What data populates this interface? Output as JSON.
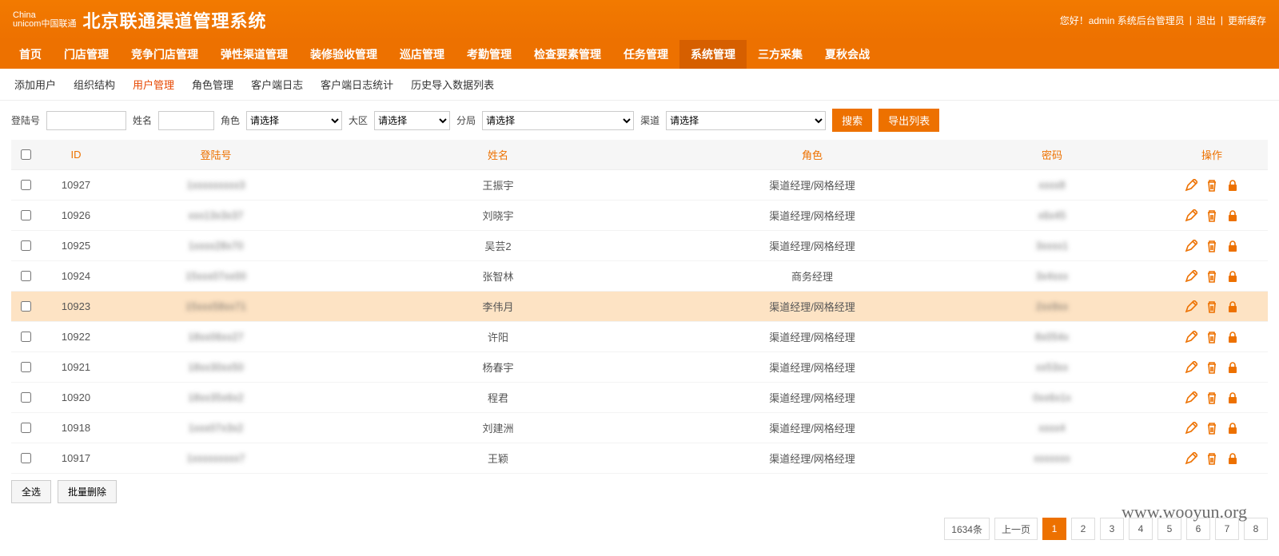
{
  "header": {
    "logo_small1": "China",
    "logo_small2": "unicom中国联通",
    "title": "北京联通渠道管理系统",
    "greeting": "您好！admin 系统后台管理员",
    "logout": "退出",
    "refresh": "更新缓存"
  },
  "nav": [
    "首页",
    "门店管理",
    "竞争门店管理",
    "弹性渠道管理",
    "装修验收管理",
    "巡店管理",
    "考勤管理",
    "检查要素管理",
    "任务管理",
    "系统管理",
    "三方采集",
    "夏秋会战"
  ],
  "nav_active": 9,
  "subnav": [
    "添加用户",
    "组织结构",
    "用户管理",
    "角色管理",
    "客户端日志",
    "客户端日志统计",
    "历史导入数据列表"
  ],
  "subnav_active": 2,
  "filters": {
    "login_label": "登陆号",
    "name_label": "姓名",
    "role_label": "角色",
    "role_placeholder": "请选择",
    "region_label": "大区",
    "region_placeholder": "请选择",
    "branch_label": "分局",
    "branch_placeholder": "请选择",
    "channel_label": "渠道",
    "channel_placeholder": "请选择",
    "search_btn": "搜索",
    "export_btn": "导出列表"
  },
  "columns": [
    "ID",
    "登陆号",
    "姓名",
    "角色",
    "密码",
    "操作"
  ],
  "rows": [
    {
      "id": "10927",
      "login": "1xxxxxxxxx3",
      "name": "王振宇",
      "role": "渠道经理/网格经理",
      "pwd": "xxxx8"
    },
    {
      "id": "10926",
      "login": "xxx13x3x37",
      "name": "刘晓宇",
      "role": "渠道经理/网格经理",
      "pwd": "x6x45"
    },
    {
      "id": "10925",
      "login": "1xxxx28x70",
      "name": "吴芸2",
      "role": "渠道经理/网格经理",
      "pwd": "3xxxx1"
    },
    {
      "id": "10924",
      "login": "15xxx07xx00",
      "name": "张智林",
      "role": "商务经理",
      "pwd": "3x4xxx"
    },
    {
      "id": "10923",
      "login": "15xxx58xx71",
      "name": "李伟月",
      "role": "渠道经理/网格经理",
      "pwd": "2xx9xx"
    },
    {
      "id": "10922",
      "login": "18xx06xx27",
      "name": "许阳",
      "role": "渠道经理/网格经理",
      "pwd": "8x054x"
    },
    {
      "id": "10921",
      "login": "18xx30xx50",
      "name": "杨春宇",
      "role": "渠道经理/网格经理",
      "pwd": "xx53xx"
    },
    {
      "id": "10920",
      "login": "18xx35x6x2",
      "name": "程君",
      "role": "渠道经理/网格经理",
      "pwd": "0xx6x1x"
    },
    {
      "id": "10918",
      "login": "1xxx07x3x2",
      "name": "刘建洲",
      "role": "渠道经理/网格经理",
      "pwd": "xxxx4"
    },
    {
      "id": "10917",
      "login": "1xxxxxxxxx7",
      "name": "王颖",
      "role": "渠道经理/网格经理",
      "pwd": "xxxxxxx"
    }
  ],
  "highlight_row": 4,
  "footer": {
    "select_all": "全选",
    "batch_delete": "批量删除"
  },
  "pager": {
    "total": "1634条",
    "prev": "上一页",
    "pages": [
      "1",
      "2",
      "3",
      "4",
      "5",
      "6",
      "7",
      "8"
    ],
    "current": 0
  },
  "watermark": "www.wooyun.org",
  "icons": {
    "edit": "edit-icon",
    "delete": "delete-icon",
    "lock": "lock-icon"
  }
}
